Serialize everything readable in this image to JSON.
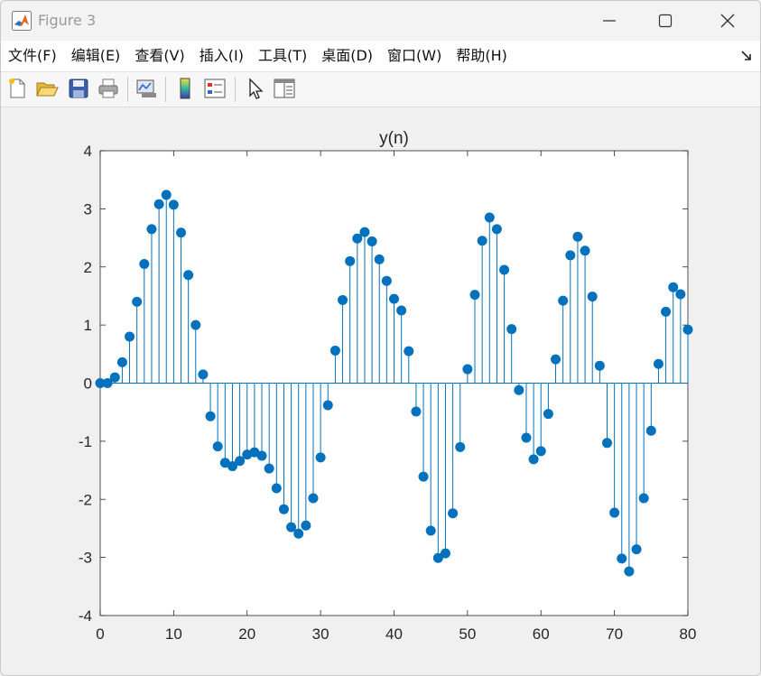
{
  "window": {
    "title": "Figure 3",
    "icon": "matlab-icon"
  },
  "menu": {
    "items": [
      "文件(F)",
      "编辑(E)",
      "查看(V)",
      "插入(I)",
      "工具(T)",
      "桌面(D)",
      "窗口(W)",
      "帮助(H)"
    ]
  },
  "toolbar": {
    "buttons": [
      "new-figure-icon",
      "open-file-icon",
      "save-icon",
      "print-icon",
      "link-plot-icon",
      "colorbar-icon",
      "legend-icon",
      "pointer-icon",
      "property-editor-icon"
    ]
  },
  "colors": {
    "stem": "#0072bd",
    "axes_bg": "#ffffff"
  },
  "chart_data": {
    "type": "stem",
    "title": "y(n)",
    "xlabel": "",
    "ylabel": "",
    "xlim": [
      0,
      80
    ],
    "ylim": [
      -4,
      4
    ],
    "xticks": [
      0,
      10,
      20,
      30,
      40,
      50,
      60,
      70,
      80
    ],
    "yticks": [
      -4,
      -3,
      -2,
      -1,
      0,
      1,
      2,
      3,
      4
    ],
    "x": [
      0,
      1,
      2,
      3,
      4,
      5,
      6,
      7,
      8,
      9,
      10,
      11,
      12,
      13,
      14,
      15,
      16,
      17,
      18,
      19,
      20,
      21,
      22,
      23,
      24,
      25,
      26,
      27,
      28,
      29,
      30,
      31,
      32,
      33,
      34,
      35,
      36,
      37,
      38,
      39,
      40,
      41,
      42,
      43,
      44,
      45,
      46,
      47,
      48,
      49,
      50,
      51,
      52,
      53,
      54,
      55,
      56,
      57,
      58,
      59,
      60,
      61,
      62,
      63,
      64,
      65,
      66,
      67,
      68,
      69,
      70,
      71,
      72,
      73,
      74,
      75,
      76,
      77,
      78,
      79,
      80
    ],
    "values": [
      0.0,
      0.0,
      0.1,
      0.36,
      0.8,
      1.4,
      2.05,
      2.65,
      3.08,
      3.24,
      3.07,
      2.59,
      1.86,
      1.0,
      0.15,
      -0.57,
      -1.09,
      -1.37,
      -1.43,
      -1.34,
      -1.23,
      -1.19,
      -1.25,
      -1.47,
      -1.81,
      -2.17,
      -2.48,
      -2.59,
      -2.45,
      -1.98,
      -1.28,
      -0.38,
      0.56,
      1.43,
      2.1,
      2.49,
      2.6,
      2.44,
      2.13,
      1.76,
      1.45,
      1.25,
      0.55,
      -0.49,
      -1.61,
      -2.54,
      -3.01,
      -2.93,
      -2.24,
      -1.1,
      0.24,
      1.52,
      2.45,
      2.85,
      2.65,
      1.95,
      0.93,
      -0.12,
      -0.94,
      -1.31,
      -1.17,
      -0.53,
      0.41,
      1.42,
      2.2,
      2.52,
      2.28,
      1.49,
      0.3,
      -1.03,
      -2.23,
      -3.02,
      -3.24,
      -2.86,
      -1.98,
      -0.82,
      0.33,
      1.23,
      1.65,
      1.53,
      0.92
    ]
  }
}
